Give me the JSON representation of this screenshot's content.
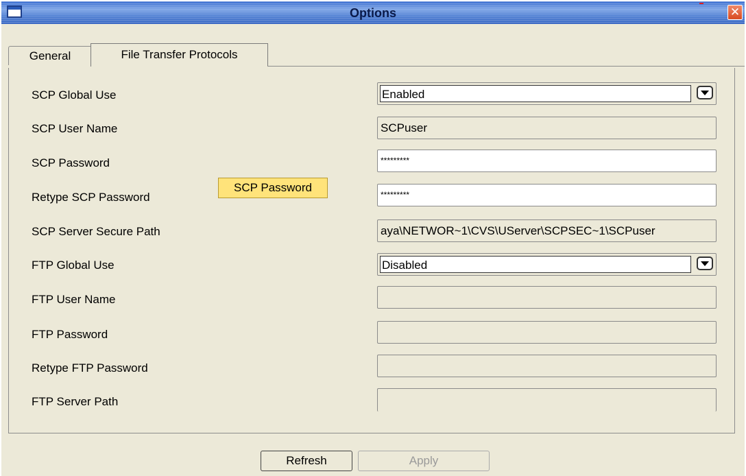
{
  "window": {
    "title": "Options",
    "close_glyph": "✕"
  },
  "tabs": [
    {
      "label": "General",
      "active": false
    },
    {
      "label": "File Transfer Protocols",
      "active": true
    }
  ],
  "form": {
    "scp_global_use": {
      "label": "SCP Global Use",
      "value": "Enabled"
    },
    "scp_user_name": {
      "label": "SCP User Name",
      "value": "SCPuser"
    },
    "scp_password": {
      "label": "SCP Password",
      "value": "*********"
    },
    "retype_scp_password": {
      "label": "Retype SCP Password",
      "value": "*********"
    },
    "scp_server_secure_path": {
      "label": "SCP Server Secure Path",
      "value": "aya\\NETWOR~1\\CVS\\UServer\\SCPSEC~1\\SCPuser"
    },
    "ftp_global_use": {
      "label": "FTP Global Use",
      "value": "Disabled"
    },
    "ftp_user_name": {
      "label": "FTP User Name",
      "value": ""
    },
    "ftp_password": {
      "label": "FTP Password",
      "value": ""
    },
    "retype_ftp_password": {
      "label": "Retype FTP Password",
      "value": ""
    },
    "ftp_server_path": {
      "label": "FTP Server Path",
      "value": ""
    }
  },
  "tooltip": {
    "text": "SCP Password"
  },
  "buttons": {
    "refresh": "Refresh",
    "apply": "Apply"
  },
  "colors": {
    "titlebar": "#4f7fd3",
    "tooltip_bg": "#ffe37a",
    "close_button": "#d84a20"
  }
}
